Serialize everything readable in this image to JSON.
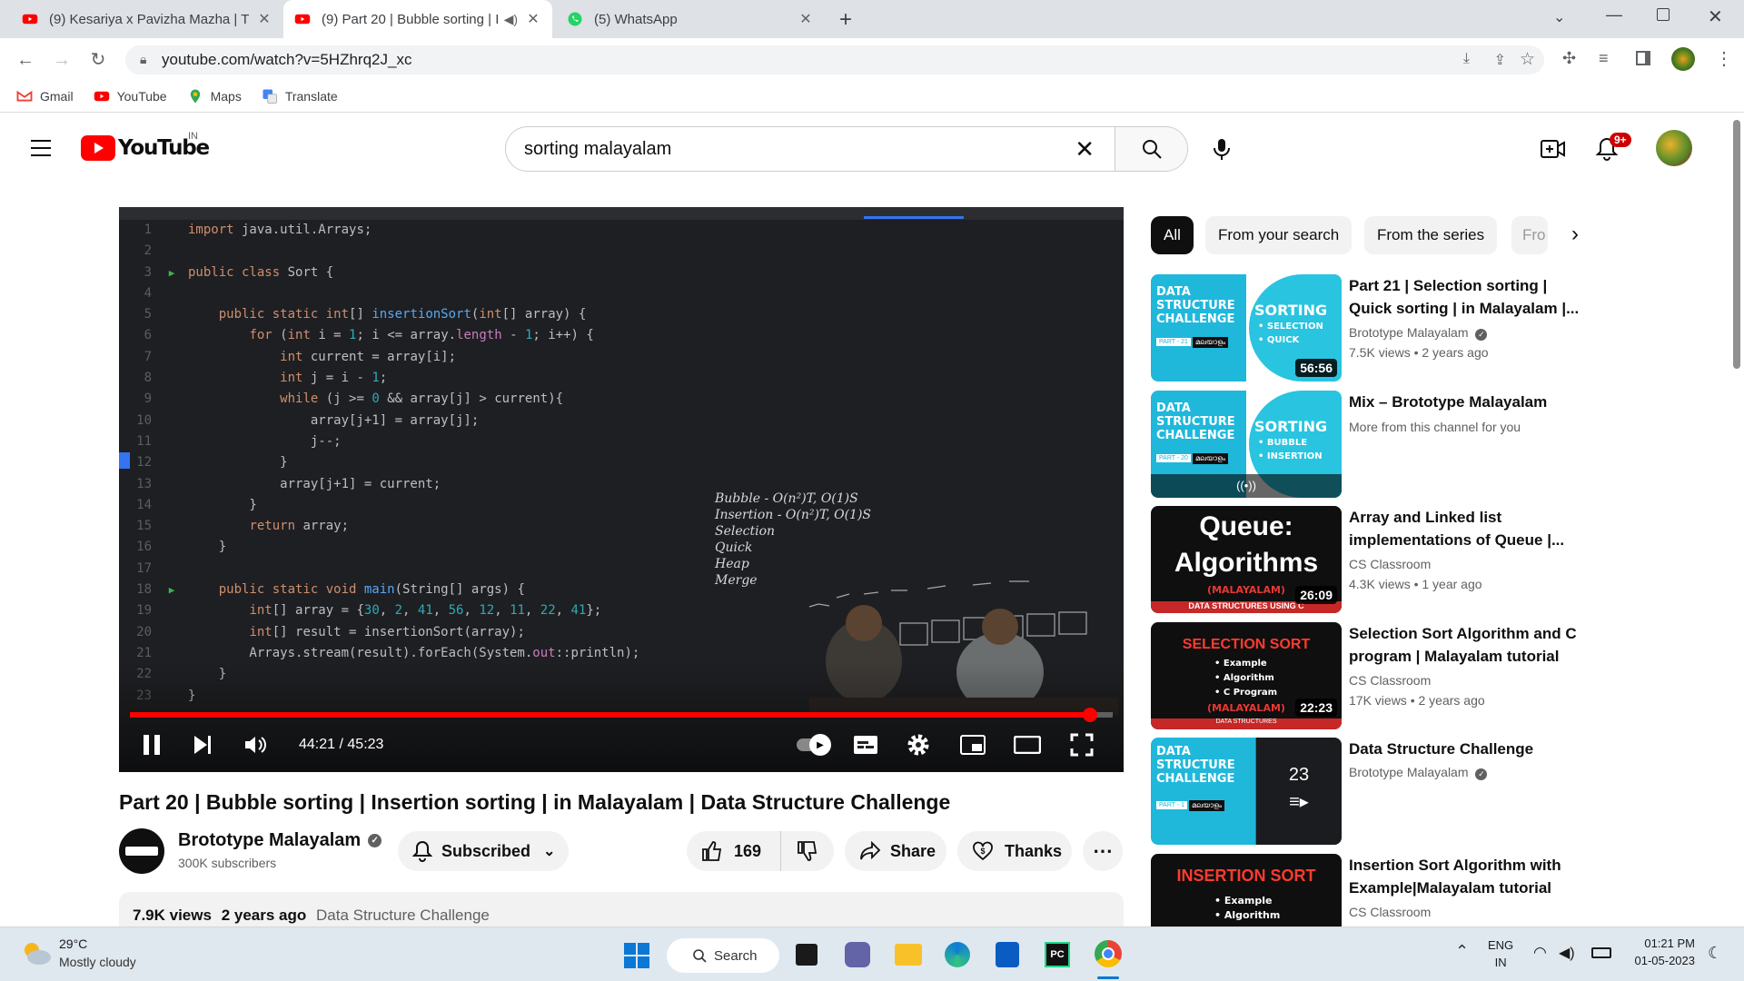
{
  "browser": {
    "tabs": [
      {
        "title": "(9) Kesariya x Pavizha Mazha | Th",
        "active": false
      },
      {
        "title": "(9) Part 20 | Bubble sorting | I",
        "active": true
      },
      {
        "title": "(5) WhatsApp",
        "active": false
      }
    ],
    "url": "youtube.com/watch?v=5HZhrq2J_xc",
    "bookmarks": [
      "Gmail",
      "YouTube",
      "Maps",
      "Translate"
    ]
  },
  "yt_header": {
    "logo_text": "YouTube",
    "country": "IN",
    "search_value": "sorting malayalam",
    "notification_count": "9+"
  },
  "player": {
    "code_lines": [
      {
        "n": "1",
        "segs": [
          [
            "kw",
            "import"
          ],
          [
            "src",
            " java.util.Arrays;"
          ]
        ]
      },
      {
        "n": "2",
        "segs": []
      },
      {
        "n": "3",
        "run": true,
        "segs": [
          [
            "kw",
            "public class"
          ],
          [
            "src",
            " Sort {"
          ]
        ]
      },
      {
        "n": "4",
        "segs": []
      },
      {
        "n": "5",
        "segs": [
          [
            "src",
            "    "
          ],
          [
            "kw",
            "public static int"
          ],
          [
            "src",
            "[] "
          ],
          [
            "fn",
            "insertionSort"
          ],
          [
            "src",
            "("
          ],
          [
            "kw",
            "int"
          ],
          [
            "src",
            "[] array) {"
          ]
        ]
      },
      {
        "n": "6",
        "segs": [
          [
            "src",
            "        "
          ],
          [
            "kw",
            "for"
          ],
          [
            "src",
            " ("
          ],
          [
            "kw",
            "int"
          ],
          [
            "src",
            " i = "
          ],
          [
            "num",
            "1"
          ],
          [
            "src",
            "; i <= array."
          ],
          [
            "sf",
            "length"
          ],
          [
            "src",
            " - "
          ],
          [
            "num",
            "1"
          ],
          [
            "src",
            "; i++) {"
          ]
        ]
      },
      {
        "n": "7",
        "segs": [
          [
            "src",
            "            "
          ],
          [
            "kw",
            "int"
          ],
          [
            "src",
            " current = array[i];"
          ]
        ]
      },
      {
        "n": "8",
        "segs": [
          [
            "src",
            "            "
          ],
          [
            "kw",
            "int"
          ],
          [
            "src",
            " j = i - "
          ],
          [
            "num",
            "1"
          ],
          [
            "src",
            ";"
          ]
        ]
      },
      {
        "n": "9",
        "segs": [
          [
            "src",
            "            "
          ],
          [
            "kw",
            "while"
          ],
          [
            "src",
            " (j >= "
          ],
          [
            "num",
            "0"
          ],
          [
            "src",
            " && array[j] > current){"
          ]
        ]
      },
      {
        "n": "10",
        "segs": [
          [
            "src",
            "                array[j+1] = array[j];"
          ]
        ]
      },
      {
        "n": "11",
        "segs": [
          [
            "src",
            "                j--;"
          ]
        ]
      },
      {
        "n": "12",
        "segs": [
          [
            "src",
            "            }"
          ]
        ]
      },
      {
        "n": "13",
        "segs": [
          [
            "src",
            "            array[j+1] = current;"
          ]
        ]
      },
      {
        "n": "14",
        "segs": [
          [
            "src",
            "        }"
          ]
        ]
      },
      {
        "n": "15",
        "segs": [
          [
            "src",
            "        "
          ],
          [
            "kw",
            "return"
          ],
          [
            "src",
            " array;"
          ]
        ]
      },
      {
        "n": "16",
        "segs": [
          [
            "src",
            "    }"
          ]
        ]
      },
      {
        "n": "17",
        "segs": []
      },
      {
        "n": "18",
        "run": true,
        "segs": [
          [
            "src",
            "    "
          ],
          [
            "kw",
            "public static void"
          ],
          [
            "src",
            " "
          ],
          [
            "fn",
            "main"
          ],
          [
            "src",
            "(String[] args) {"
          ]
        ]
      },
      {
        "n": "19",
        "segs": [
          [
            "src",
            "        "
          ],
          [
            "kw",
            "int"
          ],
          [
            "src",
            "[] array = {"
          ],
          [
            "num",
            "30"
          ],
          [
            "src",
            ", "
          ],
          [
            "num",
            "2"
          ],
          [
            "src",
            ", "
          ],
          [
            "num",
            "41"
          ],
          [
            "src",
            ", "
          ],
          [
            "num",
            "56"
          ],
          [
            "src",
            ", "
          ],
          [
            "num",
            "12"
          ],
          [
            "src",
            ", "
          ],
          [
            "num",
            "11"
          ],
          [
            "src",
            ", "
          ],
          [
            "num",
            "22"
          ],
          [
            "src",
            ", "
          ],
          [
            "num",
            "41"
          ],
          [
            "src",
            "};"
          ]
        ]
      },
      {
        "n": "20",
        "segs": [
          [
            "src",
            "        "
          ],
          [
            "kw",
            "int"
          ],
          [
            "src",
            "[] result = insertionSort(array);"
          ]
        ]
      },
      {
        "n": "21",
        "segs": [
          [
            "src",
            "        Arrays.stream(result).forEach(System."
          ],
          [
            "sf",
            "out"
          ],
          [
            "src",
            "::println);"
          ]
        ]
      },
      {
        "n": "22",
        "segs": [
          [
            "src",
            "    }"
          ]
        ]
      },
      {
        "n": "23",
        "segs": [
          [
            "src",
            "}"
          ]
        ]
      }
    ],
    "whiteboard_notes": [
      "Bubble - O(n²)T, O(1)S",
      "Insertion - O(n²)T, O(1)S",
      "Selection",
      "Quick",
      "Heap",
      "Merge"
    ],
    "time_current": "44:21",
    "time_total": "45:23",
    "progress_fraction": 0.977
  },
  "video": {
    "title": "Part 20 | Bubble sorting | Insertion sorting | in Malayalam | Data Structure Challenge",
    "channel": "Brototype Malayalam",
    "subscribers": "300K subscribers",
    "subscribe_label": "Subscribed",
    "likes": "169",
    "share_label": "Share",
    "thanks_label": "Thanks",
    "views": "7.9K views",
    "age": "2 years ago",
    "playlist": "Data Structure Challenge"
  },
  "sidebar": {
    "chips": [
      "All",
      "From your search",
      "From the series",
      "Fro"
    ],
    "recommendations": [
      {
        "title": "Part 21 | Selection sorting | Quick sorting | in Malayalam |...",
        "channel": "Brototype Malayalam",
        "verified": true,
        "meta": "7.5K views • 2 years ago",
        "duration": "56:56",
        "thumb": "ds_sel"
      },
      {
        "title": "Mix – Brototype Malayalam",
        "channel": "More from this channel for you",
        "verified": false,
        "meta": "",
        "duration": "",
        "thumb": "ds_bub"
      },
      {
        "title": "Array and Linked list implementations of Queue |...",
        "channel": "CS Classroom",
        "verified": false,
        "meta": "4.3K views • 1 year ago",
        "duration": "26:09",
        "thumb": "queue"
      },
      {
        "title": "Selection Sort Algorithm and C program | Malayalam tutorial",
        "channel": "CS Classroom",
        "verified": false,
        "meta": "17K views • 2 years ago",
        "duration": "22:23",
        "thumb": "selsort"
      },
      {
        "title": "Data Structure Challenge",
        "channel": "Brototype Malayalam",
        "verified": true,
        "meta": "",
        "duration": "",
        "thumb": "playlist",
        "count": "23"
      },
      {
        "title": "Insertion Sort Algorithm with Example|Malayalam tutorial",
        "channel": "CS Classroom",
        "verified": false,
        "meta": "",
        "duration": "",
        "thumb": "inssort"
      }
    ],
    "thumb_text": {
      "ds_title": "DATA STRUCTURE CHALLENGE",
      "sorting": "SORTING",
      "selection": "• SELECTION",
      "quick": "• QUICK",
      "bubble": "• BUBBLE",
      "insertion": "• INSERTION",
      "part21": "PART - 21",
      "part20": "PART - 20",
      "part1": "PART - 1",
      "mal": "മലയാളം",
      "queue1": "Queue:",
      "queue2": "Algorithms",
      "queue3": "(MALAYALAM)",
      "queue4": "DATA STRUCTURES USING C",
      "sel1": "SELECTION SORT",
      "sel_items": [
        "• Example",
        "• Algorithm",
        "• C Program"
      ],
      "sel_mal": "(MALAYALAM)",
      "sel_ds": "DATA STRUCTURES",
      "ins1": "INSERTION SORT",
      "ins_items": [
        "• Example",
        "• Algorithm"
      ]
    }
  },
  "taskbar": {
    "temp": "29°C",
    "weather": "Mostly cloudy",
    "search_label": "Search",
    "lang1": "ENG",
    "lang2": "IN",
    "time": "01:21 PM",
    "date": "01-05-2023"
  },
  "colors": {
    "yt_red": "#ff0000",
    "accent_cyan": "#29c4e0",
    "chrome_tab_bg": "#dee1e6"
  }
}
